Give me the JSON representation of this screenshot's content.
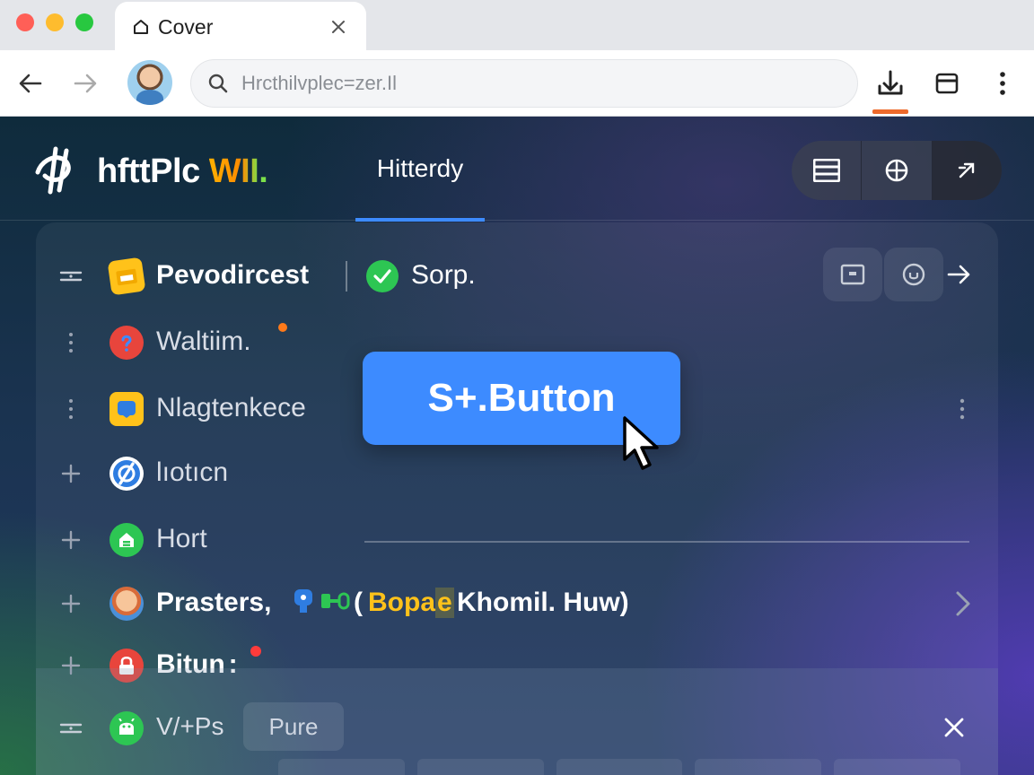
{
  "browser": {
    "tab_title": "Cover",
    "url_placeholder": "Hrcthilvplec=zer.Il",
    "icons": [
      "home-icon",
      "close-icon",
      "back-arrow-icon",
      "forward-arrow-icon",
      "search-icon",
      "download-icon",
      "save-icon",
      "more-vert-icon"
    ],
    "colors": {
      "download_accent": "#ee6a2b"
    }
  },
  "app": {
    "brand_main": "hfttPlc",
    "brand_accent": "WII.",
    "header_tab": "Hitterdy",
    "header_actions": [
      "menu-icon",
      "globe-icon",
      "expand-icon"
    ],
    "colors": {
      "primary": "#3d8bff",
      "success": "#2dc653",
      "alert": "#ff3b3b",
      "tag": "#ffc21a"
    }
  },
  "list": {
    "rows": [
      {
        "label": "Pevodircest",
        "status": "Sorp.",
        "icon": "folder-icon"
      },
      {
        "label": "Waltiim.",
        "icon": "help-icon"
      },
      {
        "label": "Nlagtenkece",
        "icon": "tag-icon"
      },
      {
        "label": "lıotıcn",
        "icon": "blocked-icon"
      },
      {
        "label": "Hort",
        "icon": "home-icon"
      },
      {
        "label_start": "Prasters,",
        "label_tag": "Bopa",
        "label_tag_cont": "e",
        "label_paren_open": "(",
        "label_end": "Khomil. Huw)",
        "icon": "avatar"
      },
      {
        "label": "Bitun",
        "label_suffix": ":",
        "icon": "lock-icon"
      },
      {
        "label": "V/+Ps",
        "pill": "Pure",
        "icon": "android-icon"
      }
    ]
  },
  "main_button": {
    "label": "S+.Button"
  }
}
